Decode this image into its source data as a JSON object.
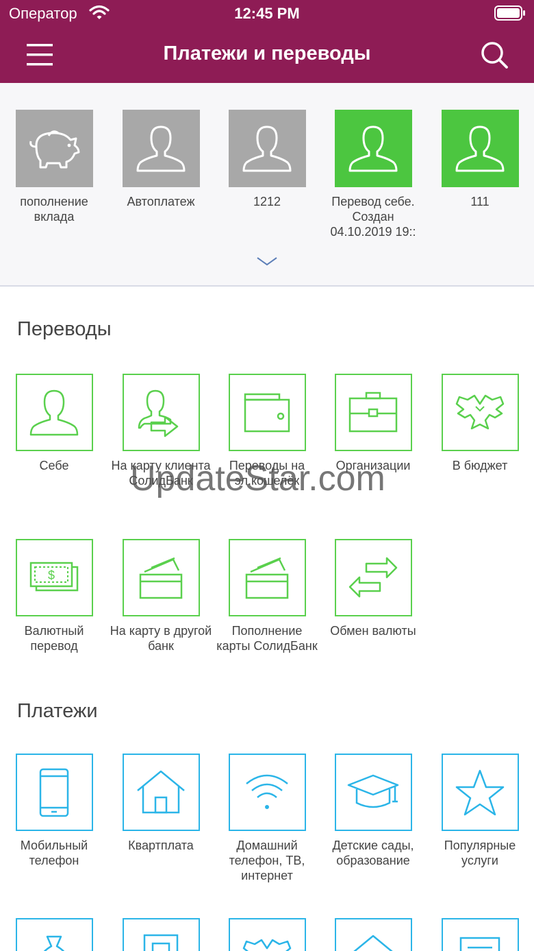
{
  "status_bar": {
    "carrier": "Оператор",
    "time": "12:45 PM"
  },
  "header": {
    "title": "Платежи и переводы"
  },
  "favorites": [
    {
      "label": "пополнение вклада"
    },
    {
      "label": "Автоплатеж"
    },
    {
      "label": "1212"
    },
    {
      "label": "Перевод себе. Создан 04.10.2019 19::"
    },
    {
      "label": "111"
    }
  ],
  "transfers": {
    "title": "Переводы",
    "items": [
      {
        "label": "Себе"
      },
      {
        "label": "На карту клиента СолидБанк"
      },
      {
        "label": "Переводы на эл.кошелёк"
      },
      {
        "label": "Организации"
      },
      {
        "label": "В бюджет"
      },
      {
        "label": "Валютный перевод"
      },
      {
        "label": "На карту в другой банк"
      },
      {
        "label": "Пополнение карты СолидБанк"
      },
      {
        "label": "Обмен валюты"
      }
    ]
  },
  "payments": {
    "title": "Платежи",
    "items": [
      {
        "label": "Мобильный телефон"
      },
      {
        "label": "Квартплата"
      },
      {
        "label": "Домашний телефон, ТВ, интернет"
      },
      {
        "label": "Детские сады, образование"
      },
      {
        "label": "Популярные услуги"
      }
    ]
  },
  "watermark": "UpdateStar.com",
  "colors": {
    "brand": "#8e1c55",
    "green": "#4cc640",
    "blue": "#2bb5e8",
    "gray_tile": "#a8a8a8"
  }
}
